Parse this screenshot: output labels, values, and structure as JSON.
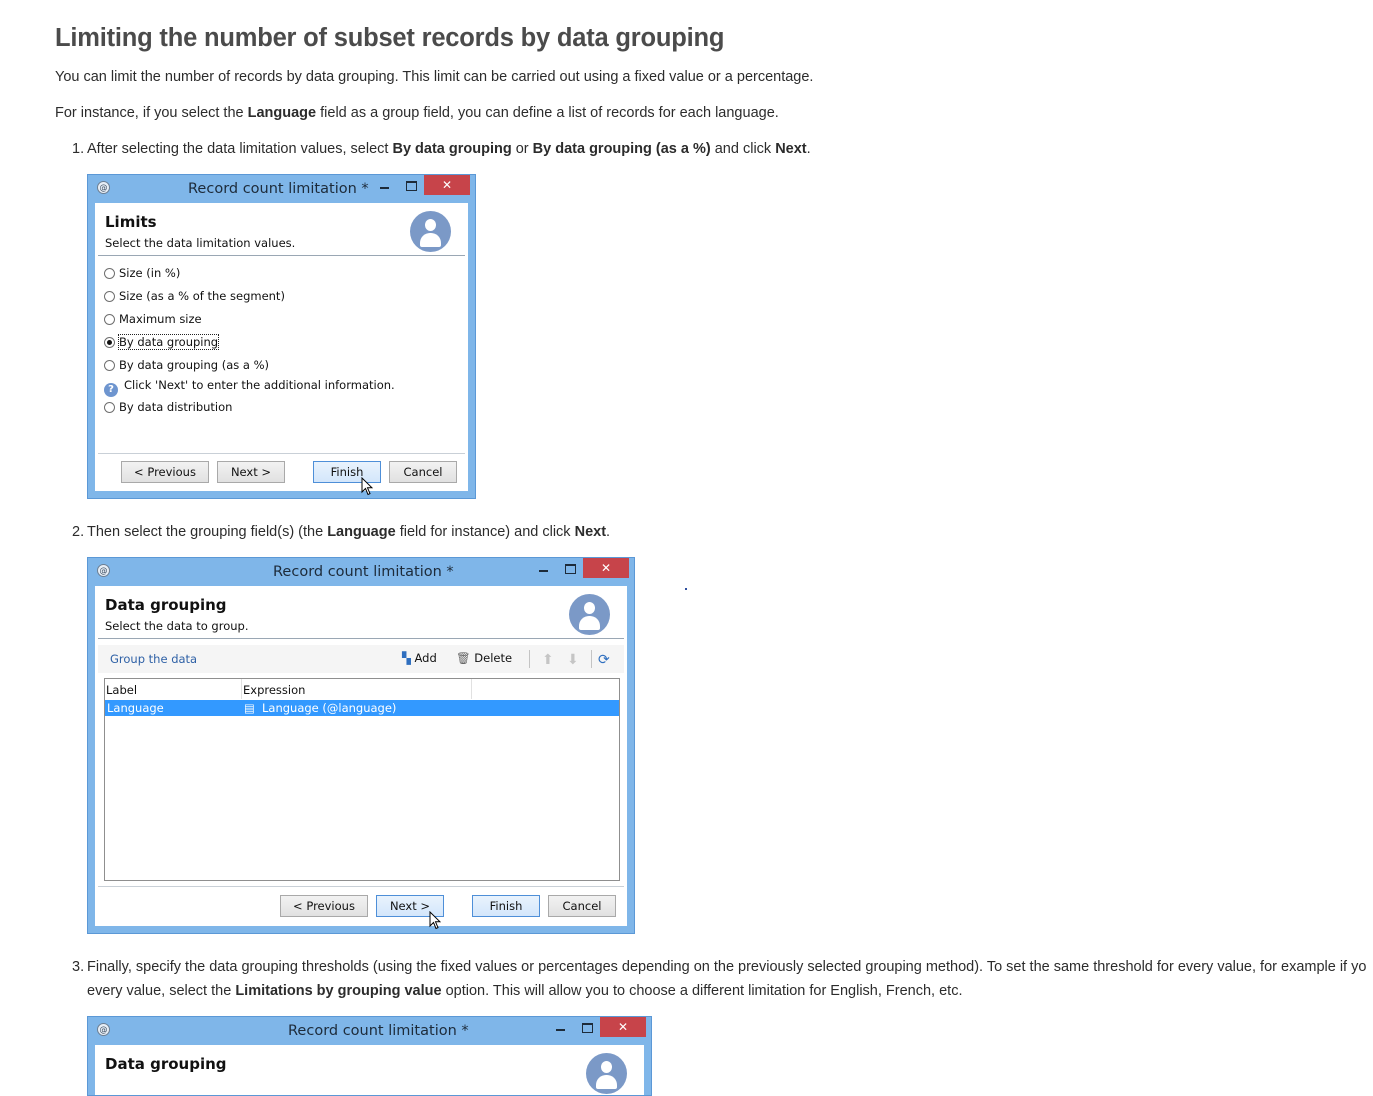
{
  "heading": "Limiting the number of subset records by data grouping",
  "intro": "You can limit the number of records by data grouping. This limit can be carried out using a fixed value or a percentage.",
  "instance": {
    "pre": "For instance, if you select the ",
    "bold": "Language",
    "post": " field as a group field, you can define a list of records for each language."
  },
  "steps": [
    {
      "num": "1.",
      "t1": "After selecting the data limitation values, select ",
      "b1": "By data grouping",
      "t2": " or ",
      "b2": "By data grouping (as a %)",
      "t3": " and click ",
      "b3": "Next",
      "t4": "."
    },
    {
      "num": "2.",
      "t1": "Then select the grouping field(s) (the ",
      "b1": "Language",
      "t2": " field for instance) and click ",
      "b2": "Next",
      "t3": "."
    },
    {
      "num": "3.",
      "line1": "Finally, specify the data grouping thresholds (using the fixed values or percentages depending on the previously selected grouping method). To set the same threshold for every value, for example if yo",
      "t1": "every value, select the ",
      "b1": "Limitations by grouping value",
      "t2": " option. This will allow you to choose a different limitation for English, French, etc."
    }
  ],
  "dialog1": {
    "title": "Record count limitation *",
    "header_title": "Limits",
    "header_sub": "Select the data limitation values.",
    "options": [
      {
        "label": "Size (in %)",
        "selected": false
      },
      {
        "label": "Size (as a % of the segment)",
        "selected": false
      },
      {
        "label": "Maximum size",
        "selected": false
      },
      {
        "label": "By data grouping",
        "selected": true
      },
      {
        "label": "By data grouping (as a %)",
        "selected": false
      }
    ],
    "info": "Click 'Next' to enter the additional information.",
    "last_option": "By data distribution",
    "buttons": {
      "previous": "< Previous",
      "next": "Next >",
      "finish": "Finish",
      "cancel": "Cancel"
    }
  },
  "dialog2": {
    "title": "Record count limitation *",
    "header_title": "Data grouping",
    "header_sub": "Select the data to group.",
    "group_label": "Group the data",
    "add": "Add",
    "delete": "Delete",
    "columns": [
      "Label",
      "Expression"
    ],
    "row": {
      "label": "Language",
      "expression": "Language (@language)"
    },
    "buttons": {
      "previous": "< Previous",
      "next": "Next >",
      "finish": "Finish",
      "cancel": "Cancel"
    }
  },
  "dialog3": {
    "title": "Record count limitation *",
    "header_title": "Data grouping"
  },
  "colors": {
    "titlebar": "#7fb6e9",
    "close": "#c7444a",
    "selection": "#3399ff",
    "avatar": "#7b99c7"
  },
  "icons": [
    "app-icon",
    "minimize-icon",
    "maximize-icon",
    "close-icon",
    "user-avatar-icon",
    "info-icon",
    "add-icon",
    "delete-icon",
    "move-up-icon",
    "move-down-icon",
    "refresh-icon",
    "list-icon",
    "mouse-cursor-icon"
  ]
}
